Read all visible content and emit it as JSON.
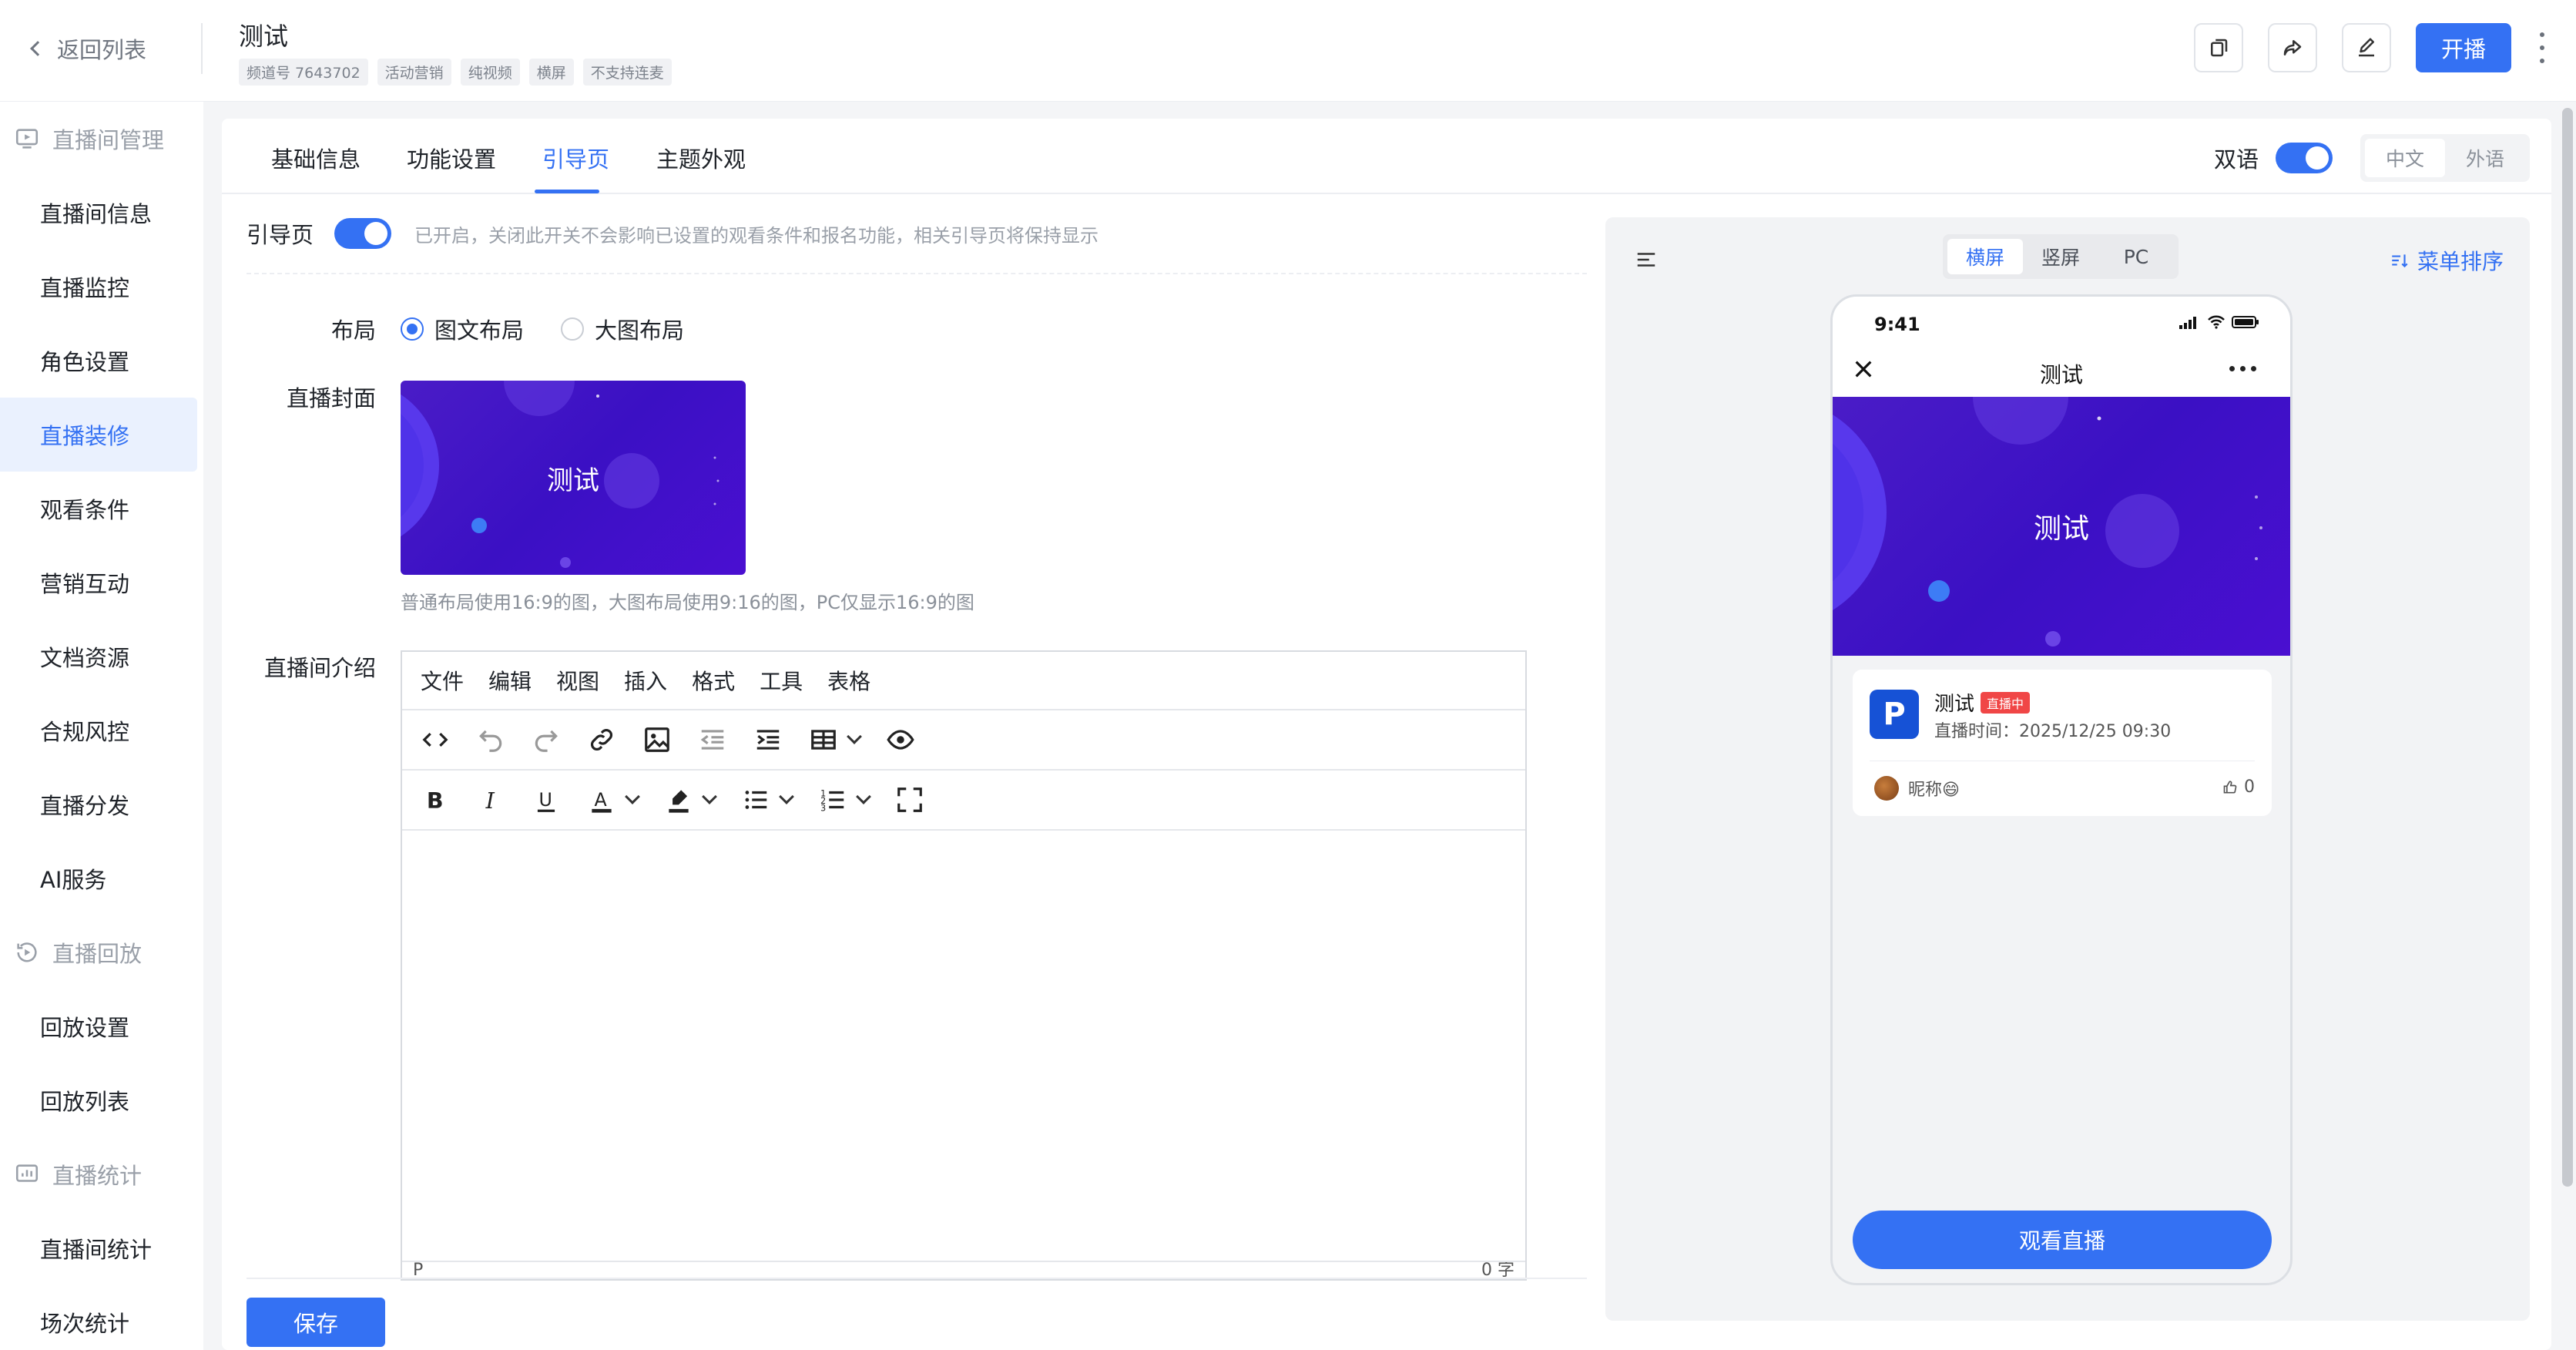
{
  "header": {
    "back_label": "返回列表",
    "title": "测试",
    "tags": [
      "频道号 7643702",
      "活动营销",
      "纯视频",
      "横屏",
      "不支持连麦"
    ],
    "start_label": "开播"
  },
  "sidebar": {
    "groups": [
      {
        "label": "直播间管理",
        "icon": "play-screen-icon",
        "items": [
          "直播间信息",
          "直播监控",
          "角色设置",
          "直播装修",
          "观看条件",
          "营销互动",
          "文档资源",
          "合规风控",
          "直播分发",
          "AI服务"
        ]
      },
      {
        "label": "直播回放",
        "icon": "replay-icon",
        "items": [
          "回放设置",
          "回放列表"
        ]
      },
      {
        "label": "直播统计",
        "icon": "stats-icon",
        "items": [
          "直播间统计",
          "场次统计"
        ]
      }
    ],
    "active_item": "直播装修"
  },
  "tabs": {
    "items": [
      "基础信息",
      "功能设置",
      "引导页",
      "主题外观"
    ],
    "active": "引导页"
  },
  "bilingual": {
    "label": "双语",
    "enabled": true,
    "options": [
      "中文",
      "外语"
    ],
    "selected": "中文"
  },
  "guide": {
    "label": "引导页",
    "enabled": true,
    "hint": "已开启，关闭此开关不会影响已设置的观看条件和报名功能，相关引导页将保持显示"
  },
  "layout": {
    "label": "布局",
    "options": [
      "图文布局",
      "大图布局"
    ],
    "selected": "图文布局"
  },
  "cover": {
    "label": "直播封面",
    "image_text": "测试",
    "hint": "普通布局使用16:9的图，大图布局使用9:16的图，PC仅显示16:9的图"
  },
  "intro": {
    "label": "直播间介绍",
    "menu": [
      "文件",
      "编辑",
      "视图",
      "插入",
      "格式",
      "工具",
      "表格"
    ],
    "status_left": "P",
    "status_right": "0 字"
  },
  "save_label": "保存",
  "preview": {
    "modes": [
      "横屏",
      "竖屏",
      "PC"
    ],
    "selected_mode": "横屏",
    "sort_label": "菜单排序",
    "phone": {
      "time": "9:41",
      "nav_title": "测试",
      "banner_text": "测试",
      "channel_logo": "P",
      "live_title": "测试",
      "live_badge": "直播中",
      "live_time": "直播时间：2025/12/25 09:30",
      "nickname": "昵称😄",
      "likes": "0",
      "watch_label": "观看直播"
    }
  },
  "colors": {
    "accent": "#3471f3",
    "banner_purple": "#3b10c4",
    "live_red": "#f04646"
  }
}
